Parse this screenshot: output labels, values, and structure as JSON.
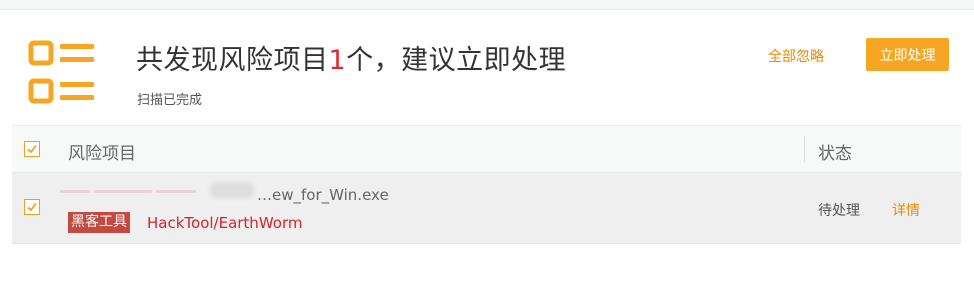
{
  "header": {
    "title_prefix": "共发现风险项目",
    "risk_count": "1",
    "title_suffix": "个，建议立即处理",
    "subtitle": "扫描已完成",
    "ignore_all_label": "全部忽略",
    "handle_now_label": "立即处理",
    "icon": "report-list-icon"
  },
  "table": {
    "columns": [
      "风险项目",
      "状态"
    ],
    "rows": [
      {
        "checked": true,
        "file_name": "…ew_for_Win.exe",
        "tag": "黑客工具",
        "threat_name": "HackTool/EarthWorm",
        "status": "待处理",
        "details_label": "详情"
      }
    ]
  },
  "colors": {
    "accent_orange": "#f6a623",
    "link_orange": "#e88a00",
    "danger_red": "#d82424",
    "tag_red": "#c24a40"
  }
}
